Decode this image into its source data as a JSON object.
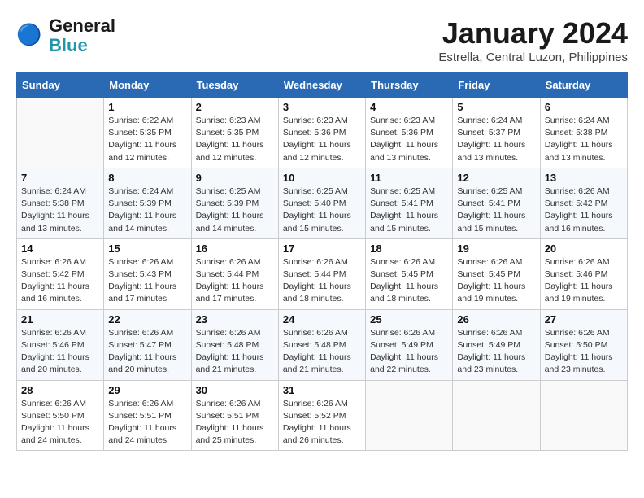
{
  "logo": {
    "text_general": "General",
    "text_blue": "Blue"
  },
  "title": "January 2024",
  "subtitle": "Estrella, Central Luzon, Philippines",
  "days_of_week": [
    "Sunday",
    "Monday",
    "Tuesday",
    "Wednesday",
    "Thursday",
    "Friday",
    "Saturday"
  ],
  "weeks": [
    [
      {
        "num": "",
        "details": ""
      },
      {
        "num": "1",
        "details": "Sunrise: 6:22 AM\nSunset: 5:35 PM\nDaylight: 11 hours\nand 12 minutes."
      },
      {
        "num": "2",
        "details": "Sunrise: 6:23 AM\nSunset: 5:35 PM\nDaylight: 11 hours\nand 12 minutes."
      },
      {
        "num": "3",
        "details": "Sunrise: 6:23 AM\nSunset: 5:36 PM\nDaylight: 11 hours\nand 12 minutes."
      },
      {
        "num": "4",
        "details": "Sunrise: 6:23 AM\nSunset: 5:36 PM\nDaylight: 11 hours\nand 13 minutes."
      },
      {
        "num": "5",
        "details": "Sunrise: 6:24 AM\nSunset: 5:37 PM\nDaylight: 11 hours\nand 13 minutes."
      },
      {
        "num": "6",
        "details": "Sunrise: 6:24 AM\nSunset: 5:38 PM\nDaylight: 11 hours\nand 13 minutes."
      }
    ],
    [
      {
        "num": "7",
        "details": "Sunrise: 6:24 AM\nSunset: 5:38 PM\nDaylight: 11 hours\nand 13 minutes."
      },
      {
        "num": "8",
        "details": "Sunrise: 6:24 AM\nSunset: 5:39 PM\nDaylight: 11 hours\nand 14 minutes."
      },
      {
        "num": "9",
        "details": "Sunrise: 6:25 AM\nSunset: 5:39 PM\nDaylight: 11 hours\nand 14 minutes."
      },
      {
        "num": "10",
        "details": "Sunrise: 6:25 AM\nSunset: 5:40 PM\nDaylight: 11 hours\nand 15 minutes."
      },
      {
        "num": "11",
        "details": "Sunrise: 6:25 AM\nSunset: 5:41 PM\nDaylight: 11 hours\nand 15 minutes."
      },
      {
        "num": "12",
        "details": "Sunrise: 6:25 AM\nSunset: 5:41 PM\nDaylight: 11 hours\nand 15 minutes."
      },
      {
        "num": "13",
        "details": "Sunrise: 6:26 AM\nSunset: 5:42 PM\nDaylight: 11 hours\nand 16 minutes."
      }
    ],
    [
      {
        "num": "14",
        "details": "Sunrise: 6:26 AM\nSunset: 5:42 PM\nDaylight: 11 hours\nand 16 minutes."
      },
      {
        "num": "15",
        "details": "Sunrise: 6:26 AM\nSunset: 5:43 PM\nDaylight: 11 hours\nand 17 minutes."
      },
      {
        "num": "16",
        "details": "Sunrise: 6:26 AM\nSunset: 5:44 PM\nDaylight: 11 hours\nand 17 minutes."
      },
      {
        "num": "17",
        "details": "Sunrise: 6:26 AM\nSunset: 5:44 PM\nDaylight: 11 hours\nand 18 minutes."
      },
      {
        "num": "18",
        "details": "Sunrise: 6:26 AM\nSunset: 5:45 PM\nDaylight: 11 hours\nand 18 minutes."
      },
      {
        "num": "19",
        "details": "Sunrise: 6:26 AM\nSunset: 5:45 PM\nDaylight: 11 hours\nand 19 minutes."
      },
      {
        "num": "20",
        "details": "Sunrise: 6:26 AM\nSunset: 5:46 PM\nDaylight: 11 hours\nand 19 minutes."
      }
    ],
    [
      {
        "num": "21",
        "details": "Sunrise: 6:26 AM\nSunset: 5:46 PM\nDaylight: 11 hours\nand 20 minutes."
      },
      {
        "num": "22",
        "details": "Sunrise: 6:26 AM\nSunset: 5:47 PM\nDaylight: 11 hours\nand 20 minutes."
      },
      {
        "num": "23",
        "details": "Sunrise: 6:26 AM\nSunset: 5:48 PM\nDaylight: 11 hours\nand 21 minutes."
      },
      {
        "num": "24",
        "details": "Sunrise: 6:26 AM\nSunset: 5:48 PM\nDaylight: 11 hours\nand 21 minutes."
      },
      {
        "num": "25",
        "details": "Sunrise: 6:26 AM\nSunset: 5:49 PM\nDaylight: 11 hours\nand 22 minutes."
      },
      {
        "num": "26",
        "details": "Sunrise: 6:26 AM\nSunset: 5:49 PM\nDaylight: 11 hours\nand 23 minutes."
      },
      {
        "num": "27",
        "details": "Sunrise: 6:26 AM\nSunset: 5:50 PM\nDaylight: 11 hours\nand 23 minutes."
      }
    ],
    [
      {
        "num": "28",
        "details": "Sunrise: 6:26 AM\nSunset: 5:50 PM\nDaylight: 11 hours\nand 24 minutes."
      },
      {
        "num": "29",
        "details": "Sunrise: 6:26 AM\nSunset: 5:51 PM\nDaylight: 11 hours\nand 24 minutes."
      },
      {
        "num": "30",
        "details": "Sunrise: 6:26 AM\nSunset: 5:51 PM\nDaylight: 11 hours\nand 25 minutes."
      },
      {
        "num": "31",
        "details": "Sunrise: 6:26 AM\nSunset: 5:52 PM\nDaylight: 11 hours\nand 26 minutes."
      },
      {
        "num": "",
        "details": ""
      },
      {
        "num": "",
        "details": ""
      },
      {
        "num": "",
        "details": ""
      }
    ]
  ]
}
